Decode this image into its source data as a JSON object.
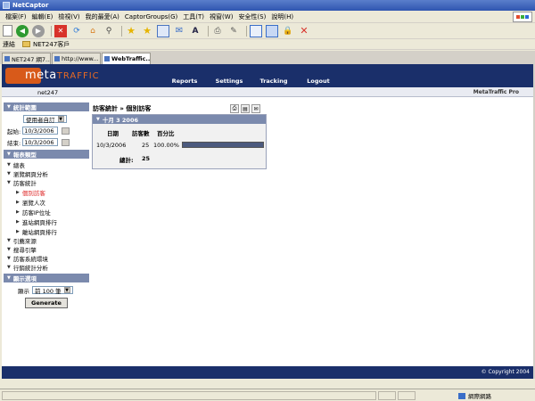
{
  "window": {
    "title": "NetCaptor"
  },
  "menu": [
    "檔案(F)",
    "編輯(E)",
    "檢視(V)",
    "我的最愛(A)",
    "CaptorGroups(G)",
    "工具(T)",
    "視窗(W)",
    "安全性(S)",
    "說明(H)"
  ],
  "links": {
    "label": "連結",
    "item": "NET247客戶"
  },
  "tabs": [
    {
      "label": "NET247 網7..."
    },
    {
      "label": "http://www..."
    },
    {
      "label": "WebTraffic..."
    }
  ],
  "header": {
    "logo_meta": "meta",
    "logo_traffic": "TRAFFIC",
    "nav": [
      "Reports",
      "Settings",
      "Tracking",
      "Logout"
    ],
    "user": "net247",
    "brand": "MetaTraffic Pro"
  },
  "sidebar": {
    "stats_range_title": "統計範圍",
    "range_select": "使用者自訂",
    "start_label": "起始:",
    "start_date": "10/3/2006",
    "end_label": "結束:",
    "end_date": "10/3/2006",
    "report_type_title": "報表類型",
    "items": [
      {
        "label": "總表"
      },
      {
        "label": "瀏覽網頁分析"
      },
      {
        "label": "訪客統計"
      }
    ],
    "sub_items": [
      {
        "label": "個別訪客",
        "active": true
      },
      {
        "label": "瀏覽人次"
      },
      {
        "label": "訪客IP位址"
      },
      {
        "label": "進站網頁排行"
      },
      {
        "label": "離站網頁排行"
      }
    ],
    "items2": [
      {
        "label": "引薦來源"
      },
      {
        "label": "搜尋引擎"
      },
      {
        "label": "訪客系統環境"
      },
      {
        "label": "行銷統計分析"
      }
    ],
    "display_title": "顯示選項",
    "display_label": "顯示",
    "display_select": "前 100 筆",
    "generate_label": "Generate"
  },
  "main": {
    "breadcrumb": "訪客統計 » 個別訪客",
    "panel_title": "十月 3 2006",
    "col_date": "日期",
    "col_visitors": "訪客數",
    "col_percent": "百分比",
    "row_date": "10/3/2006",
    "row_visitors": "25",
    "row_percent": "100.00%",
    "row_fraction": 1.0,
    "total_label": "總計:",
    "total_value": "25"
  },
  "footer": {
    "copyright": "© Copyright 2004"
  },
  "status": {
    "zone": "網際網路"
  }
}
